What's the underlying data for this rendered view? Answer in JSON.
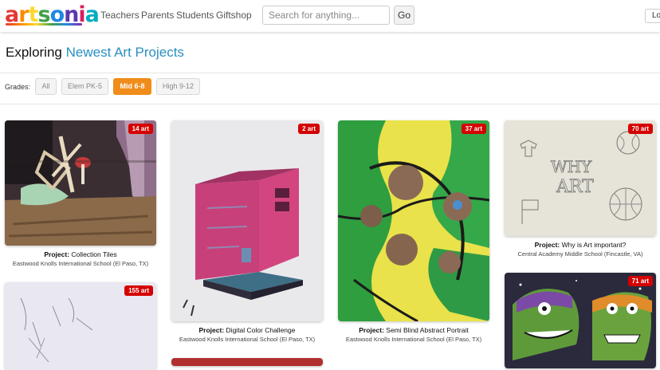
{
  "header": {
    "logo_text": "artsonia",
    "nav": [
      "Teachers",
      "Parents",
      "Students",
      "Giftshop"
    ],
    "search_placeholder": "Search for anything...",
    "go_label": "Go",
    "login_label": "Log"
  },
  "page": {
    "heading_prefix": "Exploring",
    "heading_link": "Newest Art Projects"
  },
  "grades": {
    "label": "Grades:",
    "options": [
      "All",
      "Elem PK-5",
      "Mid 6-8",
      "High 9-12"
    ],
    "selected": "Mid 6-8"
  },
  "project_prefix": "Project:",
  "projects": [
    {
      "count": "14 art",
      "title": "Collection Tiles",
      "school": "Eastwood Knolls International School (El Paso, TX)"
    },
    {
      "count": "2 art",
      "title": "Digital Color Challenge",
      "school": "Eastwood Knolls International School (El Paso, TX)"
    },
    {
      "count": "37 art",
      "title": "Semi Blind Abstract Portrait",
      "school": "Eastwood Knolls International School (El Paso, TX)"
    },
    {
      "count": "70 art",
      "title": "Why is Art important?",
      "school": "Central Academy Middle School (Fincastle, VA)"
    },
    {
      "count": "155 art",
      "title": "",
      "school": ""
    },
    {
      "count": "71 art",
      "title": "",
      "school": ""
    }
  ],
  "artwork_text": {
    "why_art": [
      "WHY",
      "ART"
    ]
  },
  "colors": {
    "accent_orange": "#f08c1a",
    "link_blue": "#2a8fc1",
    "badge_red": "#d50000"
  }
}
